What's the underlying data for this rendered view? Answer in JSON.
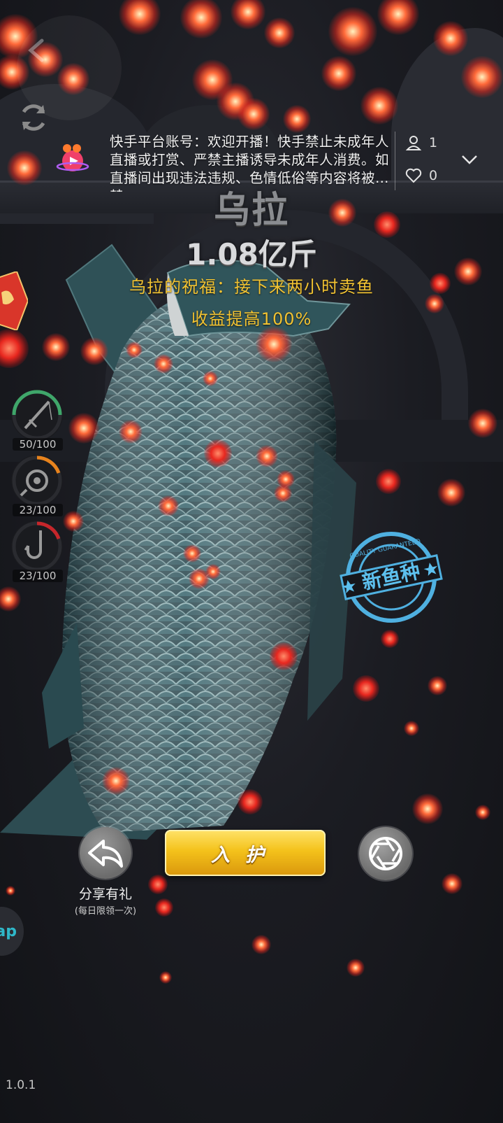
{
  "header": {
    "notice": "快手平台账号：欢迎开播！快手禁止未成年人直播或打赏、严禁主播诱导未成年人消费。如直播间出现违法违规、色情低俗等内容将被封禁。",
    "viewers": "1",
    "likes": "0"
  },
  "catch": {
    "fish_name": "乌拉",
    "weight": "1.08亿斤",
    "blessing_line1": "乌拉的祝福：接下来两小时卖鱼",
    "blessing_line2": "收益提高100%",
    "stamp_text": "新鱼种",
    "stamp_ring_text": "QUALITY GUARANTEED"
  },
  "side_gauges": [
    {
      "label": "50/100",
      "icon": "fishing-rod-icon",
      "level": 0.5,
      "color": "#3fa66a"
    },
    {
      "label": "23/100",
      "icon": "reel-icon",
      "level": 0.23,
      "color": "#e7831d"
    },
    {
      "label": "23/100",
      "icon": "hook-icon",
      "level": 0.23,
      "color": "#c6262b"
    }
  ],
  "actions": {
    "share_label": "分享有礼",
    "share_sub": "(每日限领一次)",
    "main_label": "入护",
    "side_button_label": "ap"
  },
  "footer": {
    "version": "1.0.1"
  },
  "colors": {
    "accent_gold": "#f1c232",
    "button_gold": "#f4c21b",
    "stamp_blue": "#4fb0e0"
  }
}
